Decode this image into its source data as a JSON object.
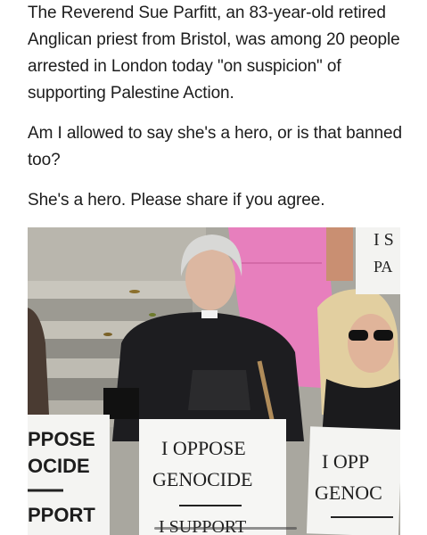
{
  "post": {
    "paragraph_1": "The Reverend Sue Parfitt, an 83-year-old retired Anglican priest from Bristol, was among 20 people arrested in London today \"on suspicion\" of supporting Palestine Action.",
    "paragraph_2": "Am I allowed to say she's a hero, or is that banned too?",
    "paragraph_3": "She's a hero. Please share if you agree."
  },
  "photo": {
    "sign_left_line1": "PPOSE",
    "sign_left_line2": "OCIDE",
    "sign_left_line3": "PPORT",
    "sign_center_line1": "I OPPOSE",
    "sign_center_line2": "GENOCIDE",
    "sign_center_line3": "I SUPPORT",
    "sign_right_line1": "I OPP",
    "sign_right_line2": "GENOC",
    "sign_top_right_line1": "I S",
    "sign_top_right_line2": "PA"
  }
}
